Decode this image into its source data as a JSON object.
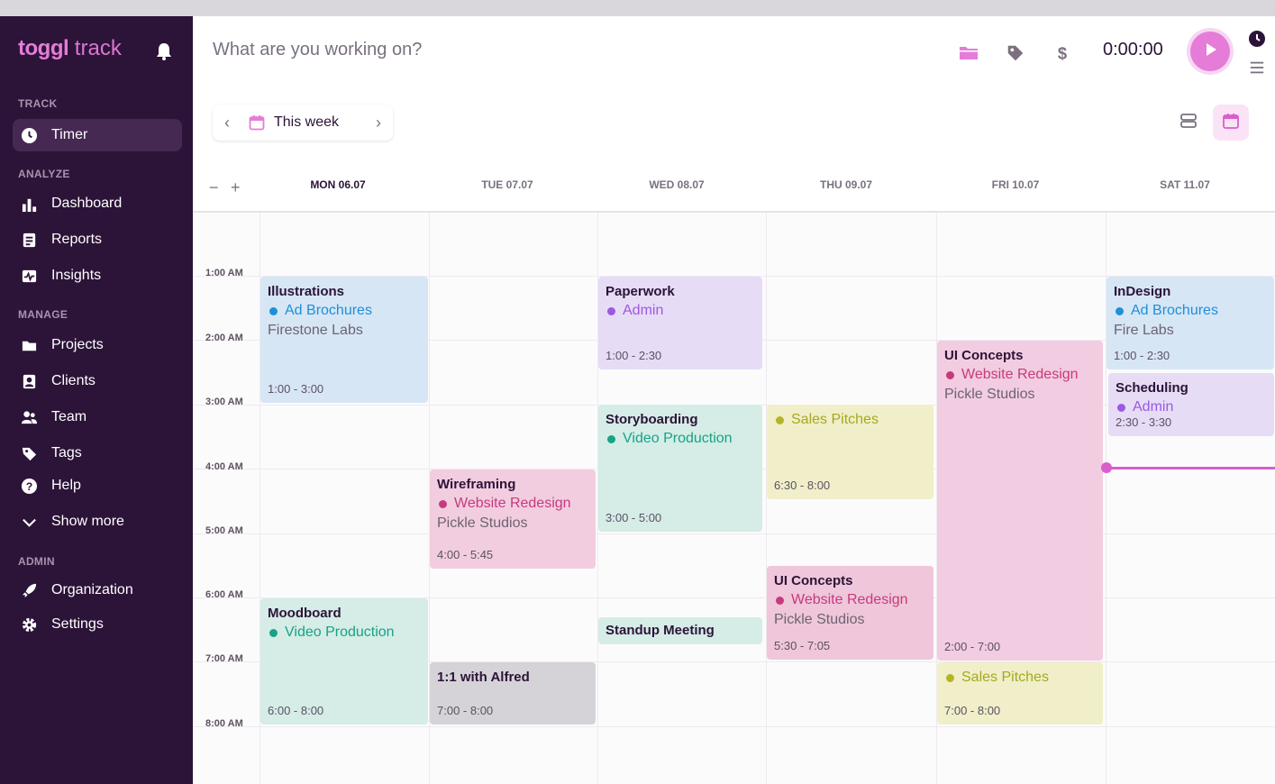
{
  "app": {
    "brand_bold": "toggl",
    "brand_light": " track"
  },
  "sidebar": {
    "sections": [
      "TRACK",
      "ANALYZE",
      "MANAGE",
      "ADMIN"
    ],
    "items": [
      {
        "label": "Timer",
        "icon": "clock-icon"
      },
      {
        "label": "Dashboard",
        "icon": "bar-chart-icon"
      },
      {
        "label": "Reports",
        "icon": "report-icon"
      },
      {
        "label": "Insights",
        "icon": "insights-icon"
      },
      {
        "label": "Projects",
        "icon": "folder-icon"
      },
      {
        "label": "Clients",
        "icon": "client-icon"
      },
      {
        "label": "Team",
        "icon": "team-icon"
      },
      {
        "label": "Tags",
        "icon": "tag-icon"
      },
      {
        "label": "Help",
        "icon": "help-icon"
      },
      {
        "label": "Show more",
        "icon": "chevron-down-icon"
      },
      {
        "label": "Organization",
        "icon": "rocket-icon"
      },
      {
        "label": "Settings",
        "icon": "gear-icon"
      }
    ]
  },
  "topbar": {
    "placeholder": "What are you working on?",
    "timer": "0:00:00"
  },
  "week": {
    "label": "This week"
  },
  "days": [
    "MON 06.07",
    "TUE 07.07",
    "WED 08.07",
    "THU 09.07",
    "FRI 10.07",
    "SAT 11.07"
  ],
  "hours": [
    "1:00 AM",
    "2:00 AM",
    "3:00 AM",
    "4:00 AM",
    "5:00 AM",
    "6:00 AM",
    "7:00 AM",
    "8:00 AM"
  ],
  "colors": {
    "sidebar": "#2c1338",
    "accent": "#e57cd8",
    "blue": "#1f8fd6",
    "purple": "#9b59e0",
    "teal": "#17a386",
    "pink": "#c73a7c",
    "olive": "#b3b529"
  },
  "events": [
    {
      "title": "Illustrations",
      "project": "Ad Brochures",
      "client": "Firestone Labs",
      "time": "1:00 - 3:00"
    },
    {
      "title": "Moodboard",
      "project": "Video Production",
      "client": "",
      "time": "6:00 - 8:00"
    },
    {
      "title": "Wireframing",
      "project": "Website Redesign",
      "client": "Pickle Studios",
      "time": "4:00 - 5:45"
    },
    {
      "title": "1:1 with Alfred",
      "project": "",
      "client": "",
      "time": "7:00 - 8:00"
    },
    {
      "title": "Paperwork",
      "project": "Admin",
      "client": "",
      "time": "1:00 - 2:30"
    },
    {
      "title": "Storyboarding",
      "project": "Video Production",
      "client": "",
      "time": "3:00 - 5:00"
    },
    {
      "title": "Standup Meeting",
      "project": "",
      "client": "",
      "time": ""
    },
    {
      "title": "",
      "project": "Sales Pitches",
      "client": "",
      "time": "6:30 - 8:00"
    },
    {
      "title": "UI Concepts",
      "project": "Website Redesign",
      "client": "Pickle Studios",
      "time": "5:30 - 7:05"
    },
    {
      "title": "UI Concepts",
      "project": "Website Redesign",
      "client": "Pickle Studios",
      "time": "2:00 - 7:00"
    },
    {
      "title": "",
      "project": "Sales Pitches",
      "client": "",
      "time": "7:00 - 8:00"
    },
    {
      "title": "InDesign",
      "project": "Ad Brochures",
      "client": "Fire Labs",
      "time": "1:00 - 2:30"
    },
    {
      "title": "Scheduling",
      "project": "Admin",
      "client": "",
      "time": "2:30 - 3:30"
    }
  ]
}
